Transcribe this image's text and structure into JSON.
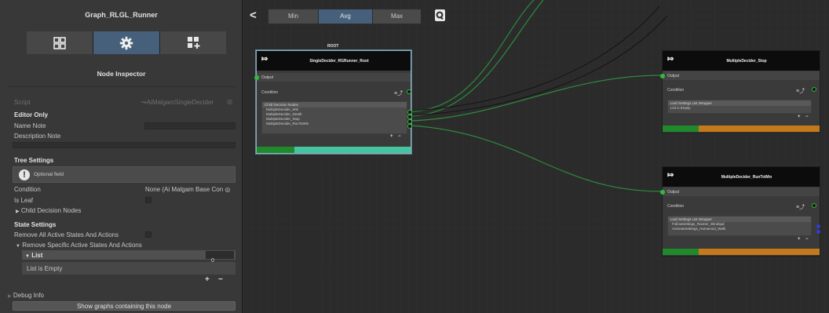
{
  "colors": {
    "accent_tab": "#46607c",
    "port_green": "#2fbb3f",
    "bar_green": "#1f8a2b",
    "bar_teal": "#45c4a0",
    "bar_orange": "#c47a1b",
    "wire_green": "#2e8a3e"
  },
  "inspector": {
    "graph_title": "Graph_RLGL_Runner",
    "tabs": [
      {
        "icon": "grid-icon"
      },
      {
        "icon": "gear-icon"
      },
      {
        "icon": "add-grid-icon"
      }
    ],
    "panel_title": "Node Inspector",
    "script_label": "Script",
    "script_value": "AiMalgamSingleDecider",
    "editor_only": "Editor Only",
    "name_note": "Name Note",
    "description_note": "Description Note",
    "tree_settings": "Tree Settings",
    "optional_field": "Optional field",
    "condition_label": "Condition",
    "condition_value": "None (Ai Malgam Base Con",
    "is_leaf": "Is Leaf",
    "child_decision_nodes": "Child Decision Nodes",
    "state_settings": "State Settings",
    "remove_all": "Remove All Active States And Actions",
    "remove_specific": "Remove Specific Active States And Actions",
    "list_label": "List",
    "list_count": "0",
    "list_empty": "List is Empty",
    "plus": "+",
    "minus": "−",
    "debug_info": "Debug Info",
    "show_graphs": "Show graphs containing this node"
  },
  "canvas": {
    "back": "<",
    "segments": [
      {
        "label": "Min"
      },
      {
        "label": "Avg"
      },
      {
        "label": "Max"
      }
    ],
    "root_label": "ROOT",
    "nodes": {
      "root": {
        "title": "SingleDecider_RGRunner_Root",
        "output": "Output",
        "condition": "Condition",
        "list_header": "Child Decision Nodes",
        "items": [
          "MultipleDecider_Win",
          "MultipleDecider_Death",
          "MultipleDecider_Stop",
          "MultipleDecider_RunToWin"
        ],
        "plus": "+",
        "minus": "−"
      },
      "stop": {
        "title": "MultipleDecider_Stop",
        "output": "Output",
        "condition": "Condition",
        "list_header": "Leaf Settings List Wrapper",
        "items": [
          "List is Empty"
        ],
        "plus": "+",
        "minus": "−"
      },
      "runtowin": {
        "title": "MultipleDecider_RunToWin",
        "output": "Output",
        "condition": "Condition",
        "list_header": "Leaf Settings List Wrapper",
        "items": [
          "FollowSettings_Runner_Windspd",
          "AnimateSettings_Humanoid_Walk"
        ],
        "plus": "+",
        "minus": "−"
      }
    }
  }
}
